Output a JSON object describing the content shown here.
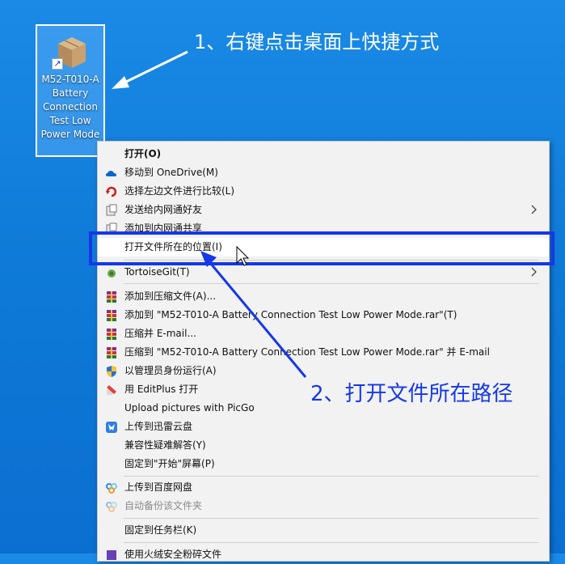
{
  "desktop_icon": {
    "label": "M52-T010-A Battery Connection Test Low Power Mode"
  },
  "annotations": {
    "step1": "1、右键点击桌面上快捷方式",
    "step2": "2、打开文件所在路径"
  },
  "context_menu": {
    "items": [
      {
        "label": "打开(O)",
        "bold": true
      },
      {
        "label": "移动到 OneDrive(M)",
        "icon": "onedrive-icon"
      },
      {
        "label": "选择左边文件进行比较(L)",
        "icon": "compare-icon"
      },
      {
        "label": "发送给内网通好友",
        "icon": "send-icon",
        "submenu": true
      },
      {
        "label": "添加到内网通共享",
        "icon": "share-icon"
      },
      {
        "label": "打开文件所在的位置(I)"
      },
      {
        "label": "TortoiseGit(T)",
        "icon": "tortoisegit-icon",
        "submenu": true
      },
      {
        "label": "添加到压缩文件(A)...",
        "icon": "winrar-icon"
      },
      {
        "label": "添加到 \"M52-T010-A Battery Connection Test Low Power Mode.rar\"(T)",
        "icon": "winrar-icon"
      },
      {
        "label": "压缩并 E-mail...",
        "icon": "winrar-icon"
      },
      {
        "label": "压缩到 \"M52-T010-A Battery Connection Test Low Power Mode.rar\" 并 E-mail",
        "icon": "winrar-icon"
      },
      {
        "label": "以管理员身份运行(A)",
        "icon": "shield-icon"
      },
      {
        "label": "用 EditPlus 打开",
        "icon": "editplus-icon"
      },
      {
        "label": "Upload pictures with PicGo",
        "icon": "none"
      },
      {
        "label": "上传到迅雷云盘",
        "icon": "xunlei-icon"
      },
      {
        "label": "兼容性疑难解答(Y)"
      },
      {
        "label": "固定到\"开始\"屏幕(P)"
      },
      {
        "label": "上传到百度网盘",
        "icon": "baidu-icon"
      },
      {
        "label": "自动备份该文件夹",
        "icon": "baidu-icon",
        "disabled": true
      },
      {
        "label": "固定到任务栏(K)"
      },
      {
        "label": "使用火绒安全粉碎文件",
        "icon": "huorong-icon"
      }
    ]
  },
  "colors": {
    "highlight": "#1538e8",
    "desktop": "#0f7bd8"
  }
}
